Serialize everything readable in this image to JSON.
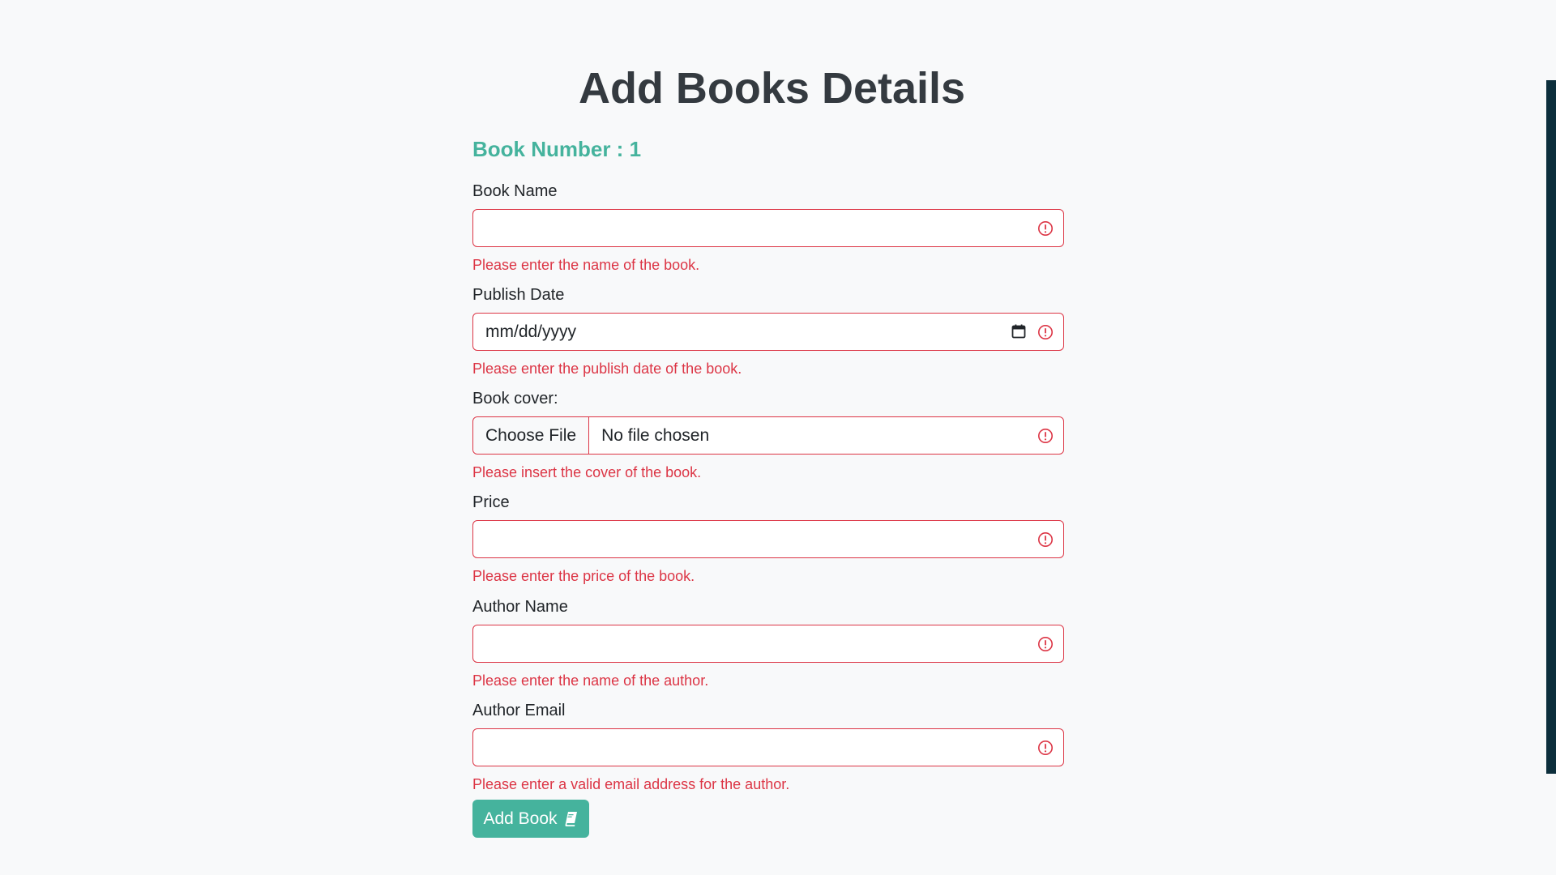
{
  "page": {
    "title": "Add Books Details",
    "book_number": "Book Number : 1"
  },
  "fields": {
    "book_name": {
      "label": "Book Name",
      "value": "",
      "feedback": "Please enter the name of the book."
    },
    "publish_date": {
      "label": "Publish Date",
      "value": "mm/dd/yyyy",
      "feedback": "Please enter the publish date of the book."
    },
    "book_cover": {
      "label": "Book cover:",
      "button": "Choose File",
      "value": "No file chosen",
      "feedback": "Please insert the cover of the book."
    },
    "price": {
      "label": "Price",
      "value": "",
      "feedback": "Please enter the price of the book."
    },
    "author_name": {
      "label": "Author Name",
      "value": "",
      "feedback": "Please enter the name of the author."
    },
    "author_email": {
      "label": "Author Email",
      "value": "",
      "feedback": "Please enter a valid email address for the author."
    }
  },
  "actions": {
    "submit_label": "Add Book"
  },
  "icons": {
    "invalid": "exclamation-circle-icon",
    "calendar": "calendar-icon",
    "book": "book-icon"
  },
  "colors": {
    "accent": "#45b39d",
    "error": "#dc3545",
    "title": "#343a40",
    "background": "#f8f9fa"
  }
}
